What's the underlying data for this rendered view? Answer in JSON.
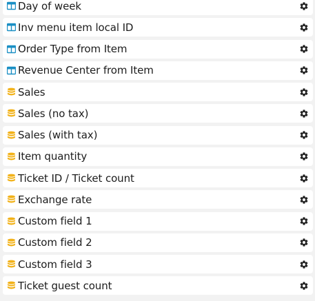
{
  "fields": [
    {
      "label": "Day of week",
      "icon": "table-icon"
    },
    {
      "label": "Inv menu item local ID",
      "icon": "table-icon"
    },
    {
      "label": "Order Type from Item",
      "icon": "table-icon"
    },
    {
      "label": "Revenue Center from Item",
      "icon": "table-icon"
    },
    {
      "label": "Sales",
      "icon": "database-icon"
    },
    {
      "label": "Sales (no tax)",
      "icon": "database-icon"
    },
    {
      "label": "Sales (with tax)",
      "icon": "database-icon"
    },
    {
      "label": "Item quantity",
      "icon": "database-icon"
    },
    {
      "label": "Ticket ID / Ticket count",
      "icon": "database-icon"
    },
    {
      "label": "Exchange rate",
      "icon": "database-icon"
    },
    {
      "label": "Custom field 1",
      "icon": "database-icon"
    },
    {
      "label": "Custom field 2",
      "icon": "database-icon"
    },
    {
      "label": "Custom field 3",
      "icon": "database-icon"
    },
    {
      "label": "Ticket guest count",
      "icon": "database-icon"
    }
  ],
  "colors": {
    "dimension_icon": "#1a8fc4",
    "measure_icon": "#f2b219",
    "gear_icon": "#222222"
  }
}
